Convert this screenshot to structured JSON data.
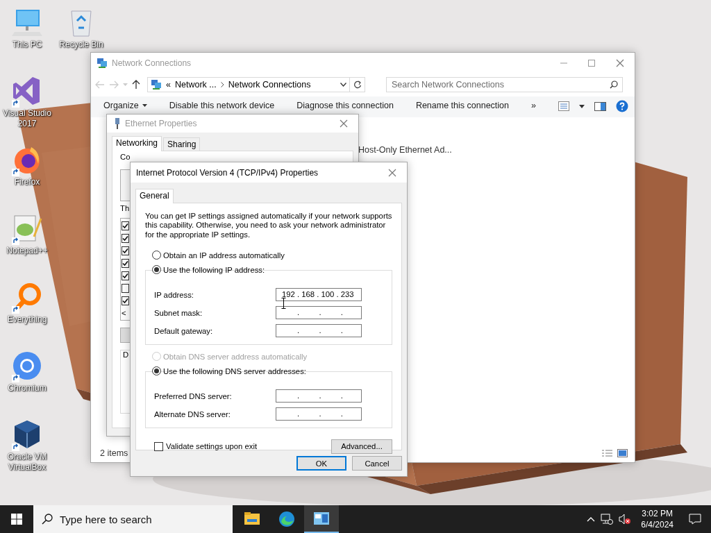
{
  "desktop": {
    "icons": [
      {
        "label": "This PC",
        "kind": "pc",
        "shortcut": false
      },
      {
        "label": "Recycle Bin",
        "kind": "recycle",
        "shortcut": false
      },
      {
        "label": "Visual Studio 2017",
        "kind": "vs",
        "shortcut": true
      },
      {
        "label": "Firefox",
        "kind": "firefox",
        "shortcut": true
      },
      {
        "label": "Notepad++",
        "kind": "notepad",
        "shortcut": true
      },
      {
        "label": "Everything",
        "kind": "everything",
        "shortcut": true
      },
      {
        "label": "Chromium",
        "kind": "chromium",
        "shortcut": true
      },
      {
        "label": "Oracle VM VirtualBox",
        "kind": "virtualbox",
        "shortcut": true
      }
    ]
  },
  "network_connections": {
    "title": "Network Connections",
    "address_prefix": "«",
    "address_segments": [
      "Network ...",
      "Network Connections"
    ],
    "search": {
      "placeholder": "Search Network Connections"
    },
    "toolbar": [
      {
        "label": "Organize",
        "kind": "menu"
      },
      {
        "label": "Disable this network device",
        "kind": "command"
      },
      {
        "label": "Diagnose this connection",
        "kind": "command"
      },
      {
        "label": "Rename this connection",
        "kind": "command"
      },
      {
        "label": "»",
        "kind": "more"
      }
    ],
    "items": [
      {
        "label": "Host-Only Ethernet Ad..."
      }
    ],
    "status_bar": "2 items"
  },
  "ethernet_properties": {
    "title": "Ethernet Properties",
    "tabs": [
      {
        "label": "Networking",
        "selected": true
      },
      {
        "label": "Sharing",
        "selected": false
      }
    ],
    "connect_label": "Co",
    "components_label": "Th",
    "components": [
      {
        "checked": true
      },
      {
        "checked": true
      },
      {
        "checked": true
      },
      {
        "checked": true
      },
      {
        "checked": true
      },
      {
        "checked": false
      },
      {
        "checked": true
      }
    ],
    "scroll_left": "<",
    "description_label": "D"
  },
  "ipv4_properties": {
    "title": "Internet Protocol Version 4 (TCP/IPv4) Properties",
    "tabs": [
      {
        "label": "General",
        "selected": true
      }
    ],
    "intro": "You can get IP settings assigned automatically if your network supports this capability. Otherwise, you need to ask your network administrator for the appropriate IP settings.",
    "ip_mode": [
      {
        "label": "Obtain an IP address automatically",
        "selected": false,
        "disabled": false
      },
      {
        "label": "Use the following IP address:",
        "selected": true,
        "disabled": false
      }
    ],
    "ip_fields": [
      {
        "label": "IP address:",
        "text": "192 . 168 . 100 . 233",
        "filled": true
      },
      {
        "label": "Subnet mask:",
        "text": ".         .         .",
        "filled": false
      },
      {
        "label": "Default gateway:",
        "text": ".         .         .",
        "filled": false
      }
    ],
    "dns_mode": [
      {
        "label": "Obtain DNS server address automatically",
        "selected": false,
        "disabled": true
      },
      {
        "label": "Use the following DNS server addresses:",
        "selected": true,
        "disabled": false
      }
    ],
    "dns_fields": [
      {
        "label": "Preferred DNS server:",
        "text": ".         .         .",
        "filled": false
      },
      {
        "label": "Alternate DNS server:",
        "text": ".         .         .",
        "filled": false
      }
    ],
    "validate": {
      "label": "Validate settings upon exit",
      "checked": false
    },
    "advanced_button": "Advanced...",
    "buttons": [
      {
        "label": "OK",
        "default": true
      },
      {
        "label": "Cancel",
        "default": false
      }
    ]
  },
  "taskbar": {
    "search_placeholder": "Type here to search",
    "apps": [
      {
        "kind": "explorer",
        "active": false
      },
      {
        "kind": "edge",
        "active": false
      },
      {
        "kind": "network",
        "active": true
      }
    ],
    "time": "3:02 PM",
    "date": "6/4/2024"
  }
}
